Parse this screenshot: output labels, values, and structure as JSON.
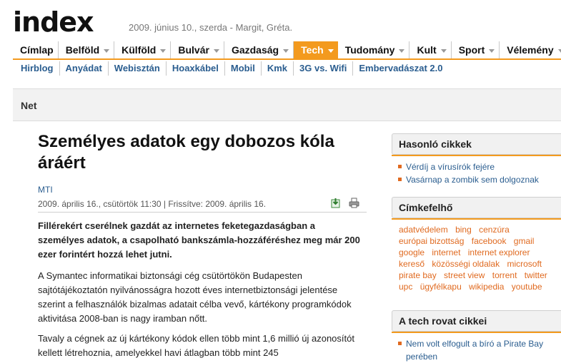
{
  "header": {
    "logo": "index",
    "date": "2009. június 10., szerda - Margit, Gréta."
  },
  "mainnav": [
    {
      "label": "Címlap",
      "arrow": false,
      "active": false
    },
    {
      "label": "Belföld",
      "arrow": true,
      "active": false
    },
    {
      "label": "Külföld",
      "arrow": true,
      "active": false
    },
    {
      "label": "Bulvár",
      "arrow": true,
      "active": false
    },
    {
      "label": "Gazdaság",
      "arrow": true,
      "active": false
    },
    {
      "label": "Tech",
      "arrow": true,
      "active": true
    },
    {
      "label": "Tudomány",
      "arrow": true,
      "active": false
    },
    {
      "label": "Kult",
      "arrow": true,
      "active": false
    },
    {
      "label": "Sport",
      "arrow": true,
      "active": false
    },
    {
      "label": "Vélemény",
      "arrow": true,
      "active": false
    }
  ],
  "subnav": [
    "Hirblog",
    "Anyádat",
    "Webisztán",
    "Hoaxkábel",
    "Mobil",
    "Kmk",
    "3G vs. Wifi",
    "Embervadászat 2.0"
  ],
  "section": {
    "title": "Net"
  },
  "article": {
    "headline": "Személyes adatok egy dobozos kóla áráért",
    "author": "MTI",
    "meta": "2009. április 16., csütörtök 11:30 | Frissítve: 2009. április 16.",
    "lead": "Fillérekért cserélnek gazdát az internetes feketegazdaságban a személyes adatok, a csapolható bankszámla-hozzáféréshez meg már 200 ezer forintért hozzá lehet jutni.",
    "paragraph1": "A Symantec informatikai biztonsági cég csütörtökön Budapesten sajtótájékoztatón nyilvánosságra hozott éves internetbiztonsági jelentése szerint a felhasználók bizalmas adatait célba vevő, kártékony programkódok aktivitása 2008-ban is nagy iramban nőtt.",
    "paragraph2": "Tavaly a cégnek az új kártékony kódok ellen több mint 1,6 millió új azonosítót kellett létrehoznia, amelyekkel havi átlagban több mint 245"
  },
  "tools": {
    "save_icon": "save-icon",
    "print_icon": "print-icon"
  },
  "sidebar": {
    "similar": {
      "title": "Hasonló cikkek",
      "items": [
        "Vérdíj a vírusírók fejére",
        "Vasárnap a zombik sem dolgoznak"
      ]
    },
    "tagcloud": {
      "title": "Címkefelhő",
      "tags": [
        "adatvédelem",
        "bing",
        "cenzúra",
        "európai bizottság",
        "facebook",
        "gmail",
        "google",
        "internet",
        "internet explorer",
        "kereső",
        "közösségi oldalak",
        "microsoft",
        "pirate bay",
        "street view",
        "torrent",
        "twitter",
        "upc",
        "ügyfélkapu",
        "wikipedia",
        "youtube"
      ]
    },
    "tech": {
      "title": "A tech rovat cikkei",
      "items": [
        "Nem volt elfogult a bíró a Pirate Bay perében"
      ]
    }
  },
  "colors": {
    "accent": "#f39a1e",
    "link": "#2a5d8f",
    "tag": "#e06a20"
  }
}
